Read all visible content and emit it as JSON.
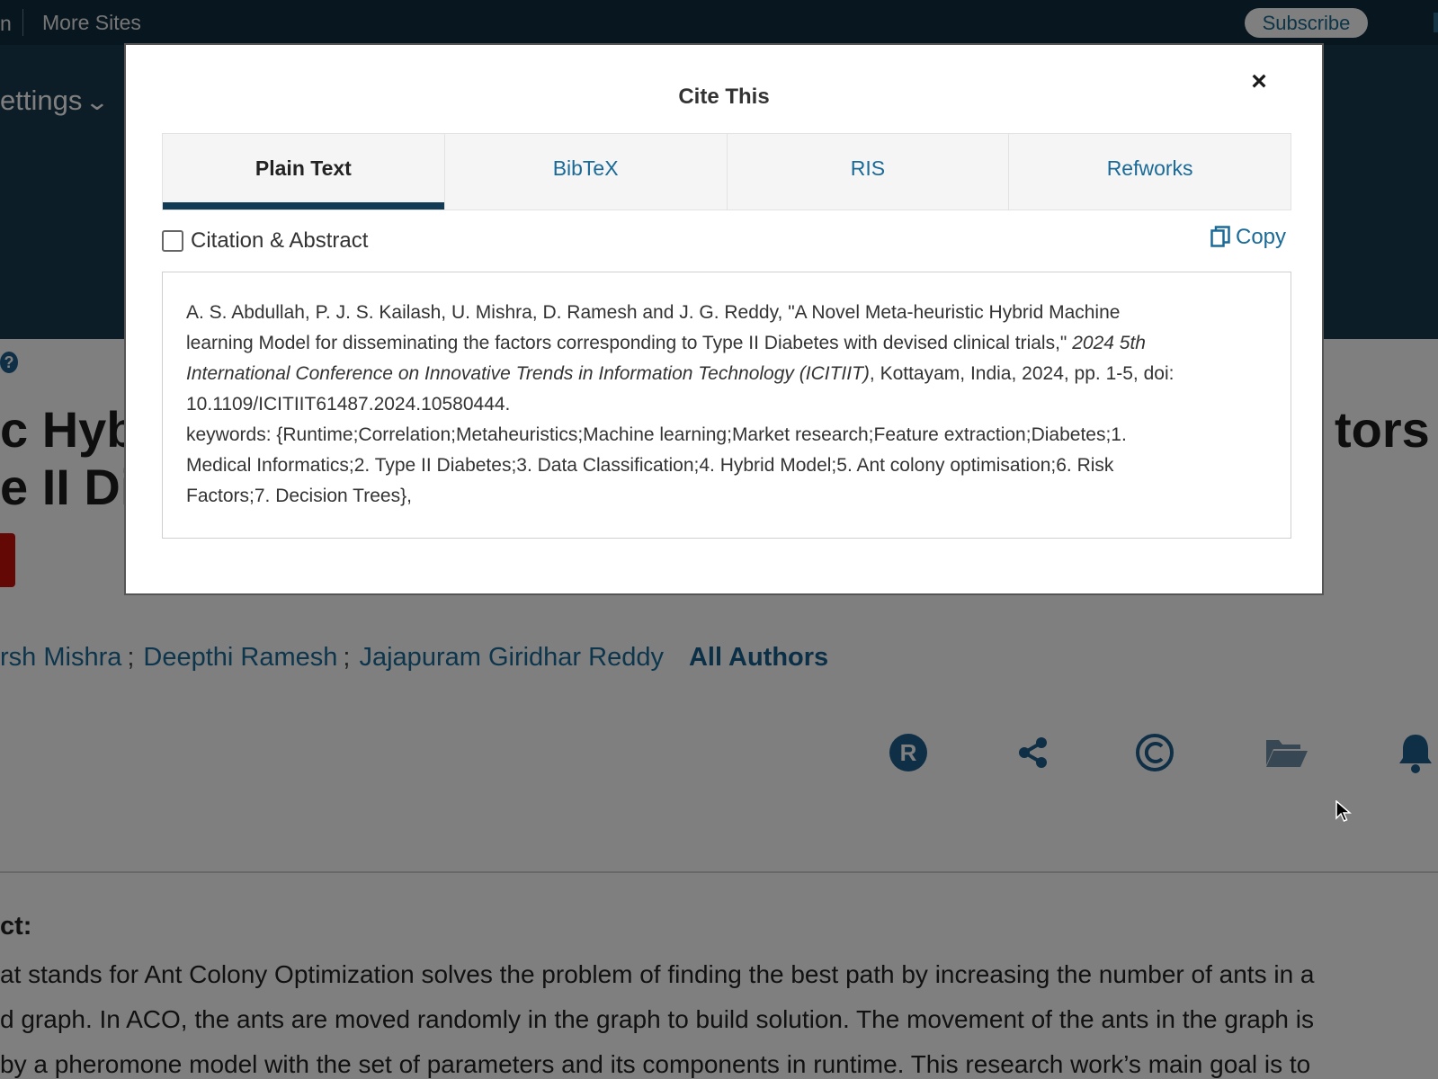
{
  "topbar": {
    "left_fragment": "n",
    "more_sites": "More Sites",
    "subscribe": "Subscribe"
  },
  "header": {
    "settings": "ettings",
    "settings_chevron": "❯"
  },
  "article": {
    "help_icon": "?",
    "title_left_line1": "c Hybr",
    "title_left_line2": "e II Dia",
    "title_right_line1": "tors",
    "authors": [
      "rsh Mishra",
      "Deepthi Ramesh",
      "Jajapuram Giridhar Reddy"
    ],
    "author_separator": ";",
    "all_authors": "All Authors",
    "toolbar_icons": [
      "rights-icon",
      "share-icon",
      "copyright-icon",
      "folder-icon",
      "bell-icon"
    ],
    "abstract_label": "ct:",
    "abstract_lines": [
      "at stands for Ant Colony Optimization solves the problem of finding the best path by increasing the number of ants in a",
      "d graph. In ACO, the ants are moved randomly in the graph to build solution. The movement of the ants in the graph is",
      "by a pheromone model with the set of parameters and its components in runtime. This research work’s main goal is to"
    ]
  },
  "modal": {
    "title": "Cite This",
    "close": "×",
    "tabs": [
      {
        "label": "Plain Text",
        "active": true
      },
      {
        "label": "BibTeX",
        "active": false
      },
      {
        "label": "RIS",
        "active": false
      },
      {
        "label": "Refworks",
        "active": false
      }
    ],
    "checkbox_label": "Citation & Abstract",
    "checkbox_checked": false,
    "copy_label": "Copy",
    "citation": {
      "line1": "A. S. Abdullah, P. J. S. Kailash, U. Mishra, D. Ramesh and J. G. Reddy, \"A Novel Meta-heuristic Hybrid Machine",
      "line2_plain": "learning Model for disseminating the factors corresponding to Type II Diabetes with devised clinical trials,\" ",
      "line2_italic": "2024 5th",
      "line3_italic": "International Conference on Innovative Trends in Information Technology (ICITIIT)",
      "line3_plain": ", Kottayam, India, 2024, pp. 1-5, doi:",
      "line4": "10.1109/ICITIIT61487.2024.10580444.",
      "line5": "keywords: {Runtime;Correlation;Metaheuristics;Machine learning;Market research;Feature extraction;Diabetes;1.",
      "line6": "Medical Informatics;2. Type II Diabetes;3. Data Classification;4. Hybrid Model;5. Ant colony optimisation;6. Risk",
      "line7": "Factors;7. Decision Trees},"
    }
  },
  "colors": {
    "topbar": "#112e3e",
    "header": "#1b3a4f",
    "link": "#1a6a98",
    "active_tab_bar": "#123b55",
    "pdf_button": "#c9110b"
  }
}
